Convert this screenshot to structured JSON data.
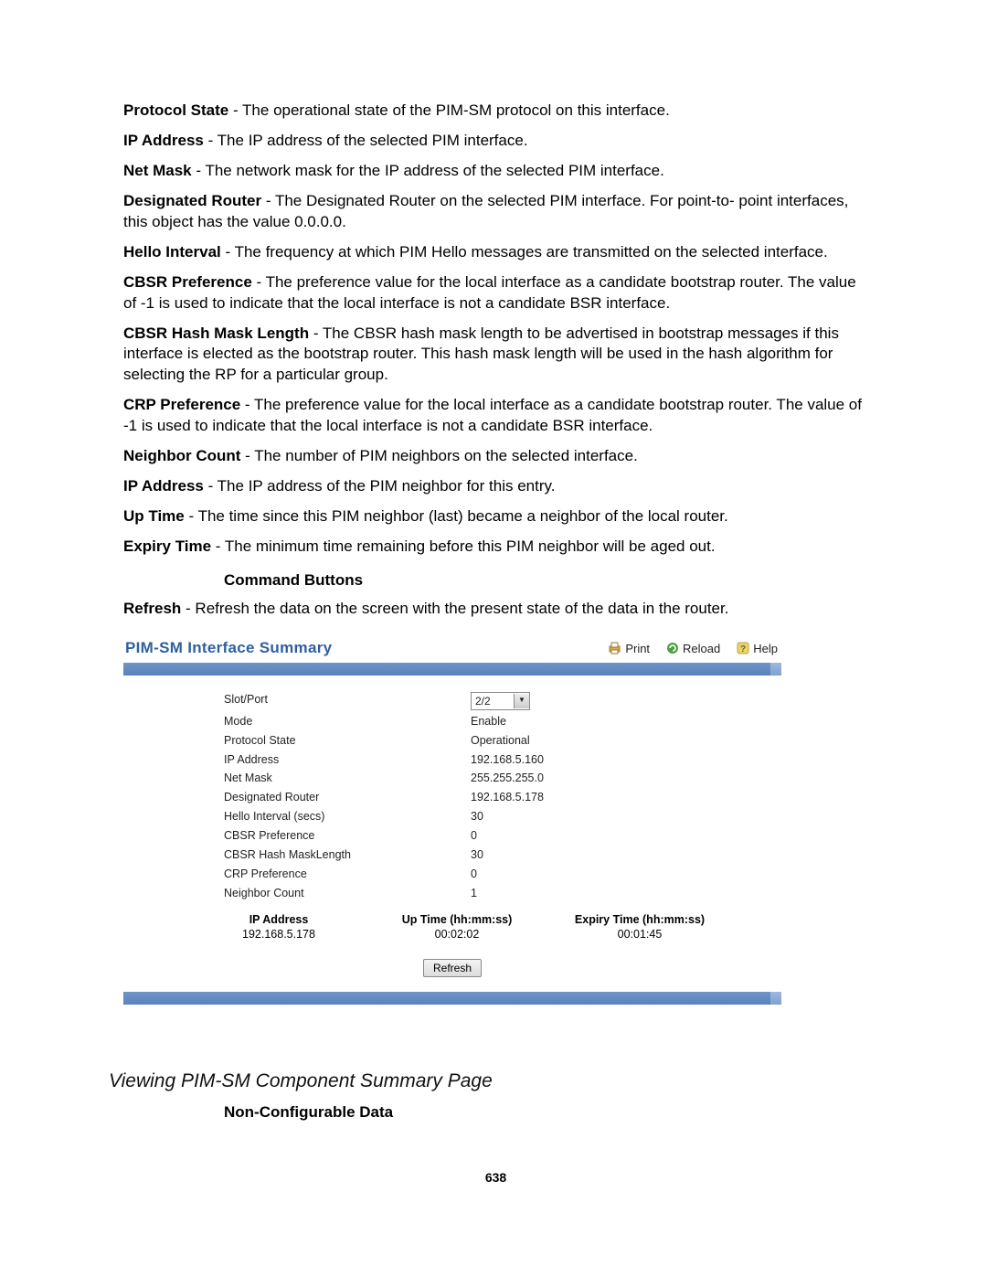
{
  "definitions": [
    {
      "term": "Protocol State",
      "desc": " - The operational state of the PIM-SM protocol on this interface."
    },
    {
      "term": "IP Address",
      "desc": " - The IP address of the selected PIM interface."
    },
    {
      "term": "Net Mask",
      "desc": " - The network mask for the IP address of the selected PIM interface."
    },
    {
      "term": "Designated Router",
      "desc": " - The Designated Router on the selected PIM interface. For point-to- point interfaces, this object has the value 0.0.0.0."
    },
    {
      "term": "Hello Interval",
      "desc": " - The frequency at which PIM Hello messages are transmitted on the selected interface."
    },
    {
      "term": "CBSR Preference",
      "desc": " - The preference value for the local interface as a candidate bootstrap router. The value of -1 is used to indicate that the local interface is not a candidate BSR interface."
    },
    {
      "term": "CBSR Hash Mask Length",
      "desc": " - The CBSR hash mask length to be advertised in bootstrap messages if this interface is elected as the bootstrap router. This hash mask length will be used in the hash algorithm for selecting the RP for a particular group."
    },
    {
      "term": "CRP Preference",
      "desc": " - The preference value for the local interface as a candidate bootstrap router. The value of -1 is used to indicate that the local interface is not a candidate BSR interface."
    },
    {
      "term": "Neighbor Count",
      "desc": " - The number of PIM neighbors on the selected interface."
    },
    {
      "term": "IP Address",
      "desc": " - The IP address of the PIM neighbor for this entry."
    },
    {
      "term": "Up Time",
      "desc": " - The time since this PIM neighbor (last) became a neighbor of the local router."
    },
    {
      "term": "Expiry Time",
      "desc": " - The minimum time remaining before this PIM neighbor will be aged out."
    }
  ],
  "command_buttons_heading": "Command Buttons",
  "refresh_def": {
    "term": "Refresh",
    "desc": " - Refresh the data on the screen with the present state of the data in the router."
  },
  "screenshot": {
    "title": "PIM-SM Interface Summary",
    "tools": {
      "print": "Print",
      "reload": "Reload",
      "help": "Help"
    },
    "rows": [
      {
        "label": "Slot/Port",
        "value": "2/2",
        "type": "select"
      },
      {
        "label": "Mode",
        "value": "Enable"
      },
      {
        "label": "Protocol State",
        "value": "Operational"
      },
      {
        "label": "IP Address",
        "value": "192.168.5.160"
      },
      {
        "label": "Net Mask",
        "value": "255.255.255.0"
      },
      {
        "label": "Designated Router",
        "value": "192.168.5.178"
      },
      {
        "label": "Hello Interval (secs)",
        "value": "30"
      },
      {
        "label": "CBSR Preference",
        "value": "0"
      },
      {
        "label": "CBSR Hash MaskLength",
        "value": "30"
      },
      {
        "label": "CRP Preference",
        "value": "0"
      },
      {
        "label": "Neighbor Count",
        "value": "1"
      }
    ],
    "neighbor_headers": {
      "ip": "IP Address",
      "up": "Up Time (hh:mm:ss)",
      "exp": "Expiry Time (hh:mm:ss)"
    },
    "neighbor_row": {
      "ip": "192.168.5.178",
      "up": "00:02:02",
      "exp": "00:01:45"
    },
    "refresh_btn": "Refresh"
  },
  "section_title": "Viewing PIM-SM Component Summary Page",
  "sub_heading": "Non-Configurable Data",
  "page_number": "638"
}
